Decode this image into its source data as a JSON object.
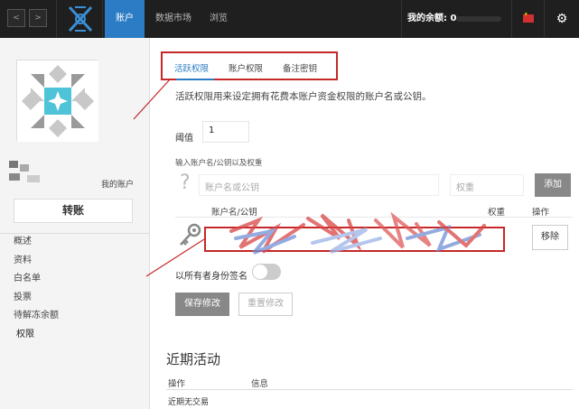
{
  "topbar": {
    "back_label": "<",
    "forward_label": ">",
    "tabs": [
      {
        "label": "账户"
      },
      {
        "label": "数据市场"
      },
      {
        "label": "浏览"
      }
    ],
    "balance_label": "我的余额: 0",
    "accent_color": "#2b7cc4"
  },
  "sidebar": {
    "my_account_label": "我的账户",
    "transfer_label": "转账",
    "menu": [
      {
        "label": "概述"
      },
      {
        "label": "资料"
      },
      {
        "label": "白名单"
      },
      {
        "label": "投票"
      },
      {
        "label": "待解冻余额"
      },
      {
        "label": "权限"
      }
    ]
  },
  "main": {
    "tabs": [
      {
        "label": "活跃权限"
      },
      {
        "label": "账户权限"
      },
      {
        "label": "备注密钥"
      }
    ],
    "description": "活跃权限用来设定拥有花费本账户资金权限的账户名或公钥。",
    "threshold_label": "阈值",
    "threshold_value": "1",
    "input_hint": "输入账户名/公钥以及权重",
    "name_placeholder": "账户名或公钥",
    "weight_placeholder": "权重",
    "add_label": "添加",
    "table": {
      "col_name": "账户名/公钥",
      "col_weight": "权重",
      "col_action": "操作"
    },
    "remove_label": "移除",
    "multisig_label": "以所有者身份签名",
    "save_label": "保存修改",
    "reset_label": "重置修改"
  },
  "recent": {
    "title": "近期活动",
    "col_action": "操作",
    "col_info": "信息",
    "empty_text": "近期无交易"
  },
  "colors": {
    "highlight_red": "#c62828",
    "topbar_bg": "#1f1f1f"
  }
}
